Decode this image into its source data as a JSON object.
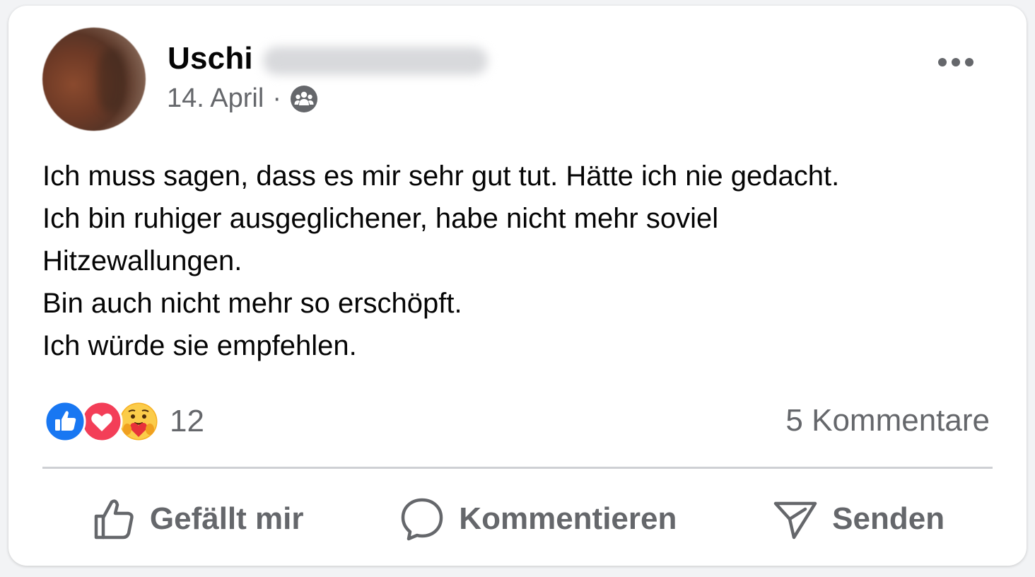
{
  "post": {
    "author_name": "Uschi",
    "date": "14. April",
    "separator": "·",
    "audience_icon": "friends-group-icon",
    "lines": [
      "Ich muss sagen, dass es mir sehr gut tut. Hätte ich nie gedacht.",
      "Ich bin ruhiger ausgeglichener, habe nicht mehr soviel",
      "Hitzewallungen.",
      "Bin auch nicht mehr so erschöpft.",
      "Ich würde sie empfehlen."
    ]
  },
  "stats": {
    "reaction_icons": [
      "like-reaction-icon",
      "love-reaction-icon",
      "care-reaction-icon"
    ],
    "reaction_count": "12",
    "comments": "5 Kommentare"
  },
  "actions": {
    "like_label": "Gefällt mir",
    "comment_label": "Kommentieren",
    "send_label": "Senden"
  },
  "colors": {
    "text": "#050505",
    "secondary": "#65676b",
    "like_blue": "#1877f2",
    "love_red": "#f33e58",
    "care_yellow": "#f7b125"
  }
}
